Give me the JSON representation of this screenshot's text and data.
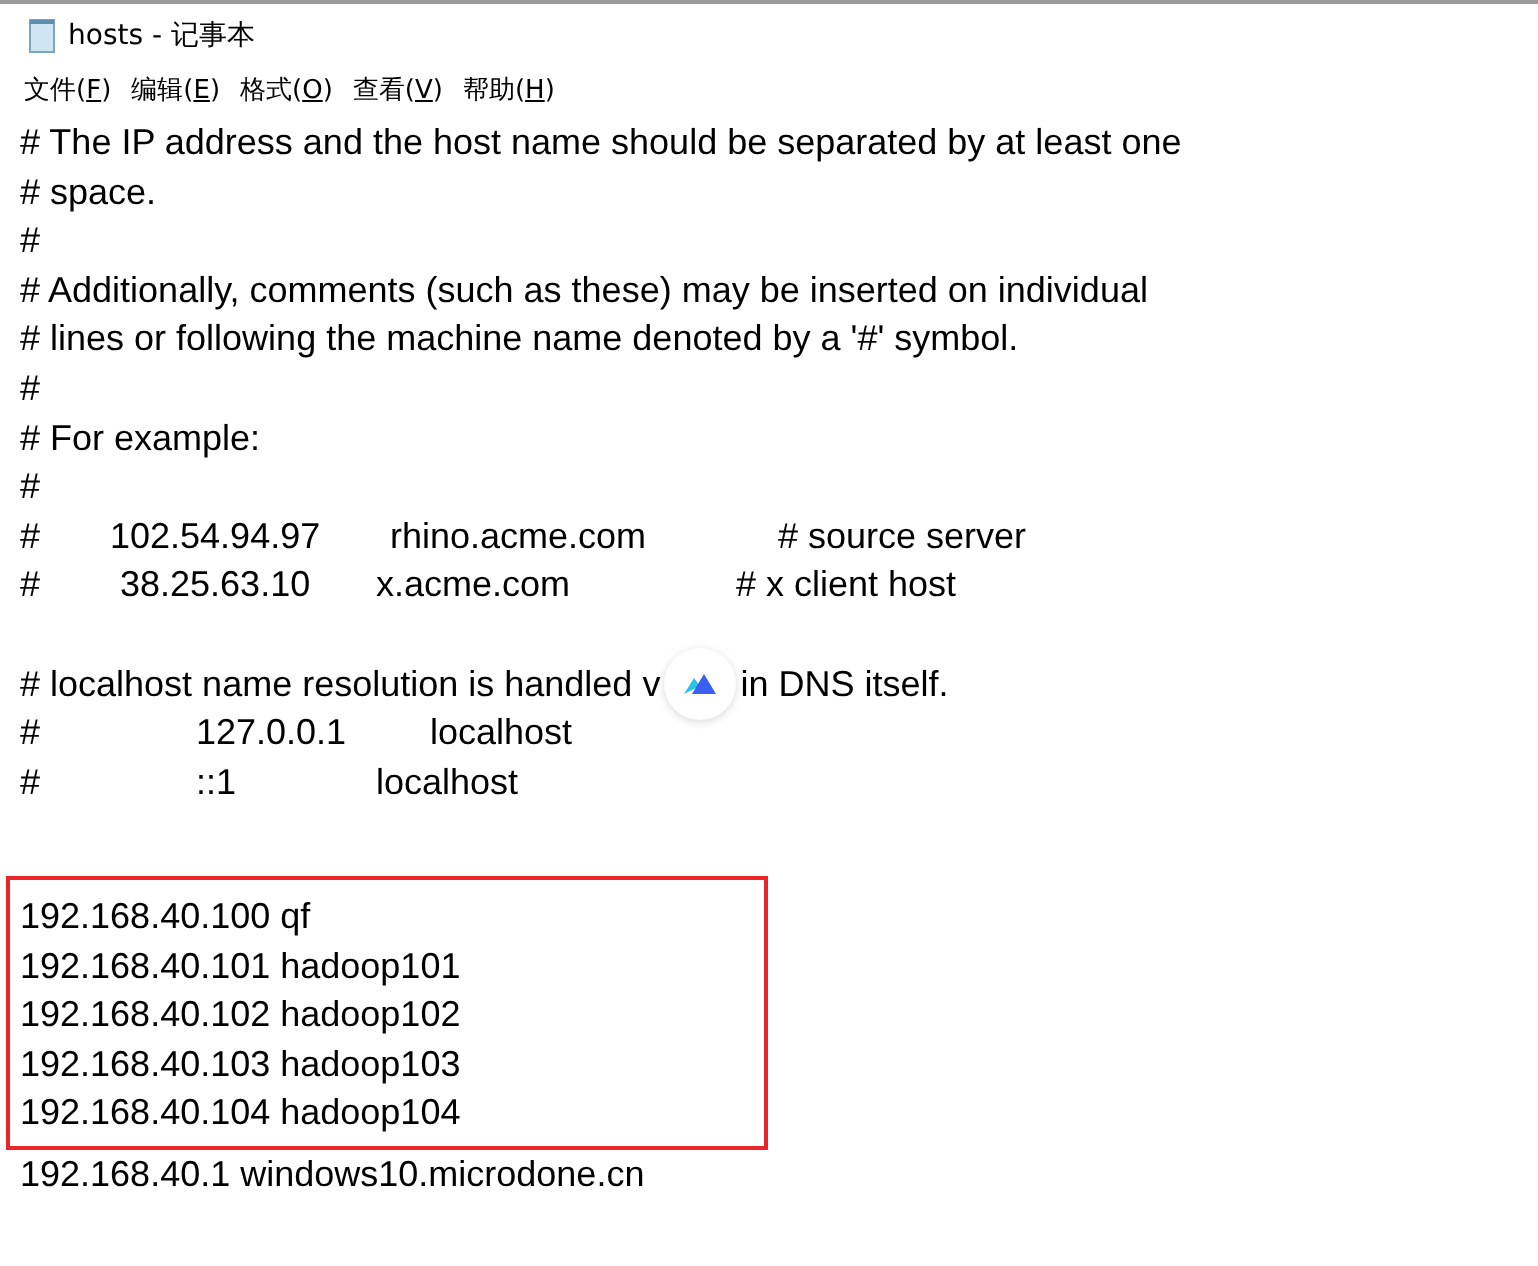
{
  "window": {
    "title": "hosts - 记事本"
  },
  "menu": [
    {
      "label": "文件(",
      "key": "F",
      "end": ")"
    },
    {
      "label": "编辑(",
      "key": "E",
      "end": ")"
    },
    {
      "label": "格式(",
      "key": "O",
      "end": ")"
    },
    {
      "label": "查看(",
      "key": "V",
      "end": ")"
    },
    {
      "label": "帮助(",
      "key": "H",
      "end": ")"
    }
  ],
  "document": {
    "blocks": [
      {
        "kind": "lines",
        "lines": [
          {
            "kind": "text",
            "text": "# The IP address and the host name should be separated by at least one"
          },
          {
            "kind": "text",
            "text": "# space."
          },
          {
            "kind": "text",
            "text": "#"
          },
          {
            "kind": "text",
            "text": "# Additionally, comments (such as these) may be inserted on individual"
          },
          {
            "kind": "text",
            "text": "# lines or following the machine name denoted by a '#' symbol."
          },
          {
            "kind": "text",
            "text": "#"
          },
          {
            "kind": "text",
            "text": "# For example:"
          },
          {
            "kind": "text",
            "text": "#"
          },
          {
            "kind": "entry",
            "parts": [
              "#",
              "102.54.94.97",
              "rhino.acme.com",
              "# source server"
            ]
          },
          {
            "kind": "entry",
            "parts": [
              "#",
              "38.25.63.10",
              "x.acme.com",
              "# x client host"
            ]
          },
          {
            "kind": "blank"
          },
          {
            "kind": "covered",
            "parts": [
              "# localhost name resolution is handled v",
              "in DNS itself."
            ]
          },
          {
            "kind": "entry",
            "parts": [
              "#",
              "127.0.0.1",
              "localhost"
            ]
          },
          {
            "kind": "entry",
            "parts": [
              "#",
              "::1",
              "localhost"
            ]
          },
          {
            "kind": "blank"
          }
        ]
      },
      {
        "kind": "boxed",
        "lines": [
          {
            "kind": "text",
            "text": "192.168.40.100 qf"
          },
          {
            "kind": "text",
            "text": "192.168.40.101 hadoop101"
          },
          {
            "kind": "text",
            "text": "192.168.40.102 hadoop102"
          },
          {
            "kind": "text",
            "text": "192.168.40.103 hadoop103"
          },
          {
            "kind": "text",
            "text": "192.168.40.104 hadoop104"
          }
        ]
      },
      {
        "kind": "lines",
        "lines": [
          {
            "kind": "text",
            "text": "192.168.40.1 windows10.microdone.cn"
          }
        ]
      }
    ]
  }
}
